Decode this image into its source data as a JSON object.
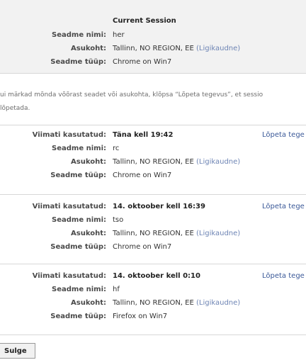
{
  "current_session": {
    "title": "Current Session",
    "device_name_label": "Seadme nimi:",
    "device_name": "her",
    "location_label": "Asukoht:",
    "location": "Tallinn, NO REGION, EE",
    "location_note": "(Ligikaudne)",
    "device_type_label": "Seadme tüüp:",
    "device_type": "Chrome on Win7"
  },
  "info": {
    "line1": "ui märkad mõnda võõrast seadet või asukohta, klõpsa “Lõpeta tegevus”, et sessio",
    "line2": "lõpetada."
  },
  "labels": {
    "last_used": "Viimati kasutatud:",
    "device_name": "Seadme nimi:",
    "location": "Asukoht:",
    "device_type": "Seadme tüüp:",
    "end_activity": "Lõpeta tege"
  },
  "sessions": [
    {
      "last_used": "Täna kell 19:42",
      "device_name": "rc",
      "location": "Tallinn, NO REGION, EE",
      "location_note": "(Ligikaudne)",
      "device_type": "Chrome on Win7"
    },
    {
      "last_used": "14. oktoober kell 16:39",
      "device_name": "tso",
      "location": "Tallinn, NO REGION, EE",
      "location_note": "(Ligikaudne)",
      "device_type": "Chrome on Win7"
    },
    {
      "last_used": "14. oktoober kell 0:10",
      "device_name": "hf",
      "location": "Tallinn, NO REGION, EE",
      "location_note": "(Ligikaudne)",
      "device_type": "Firefox on Win7"
    }
  ],
  "close_button": "Sulge"
}
